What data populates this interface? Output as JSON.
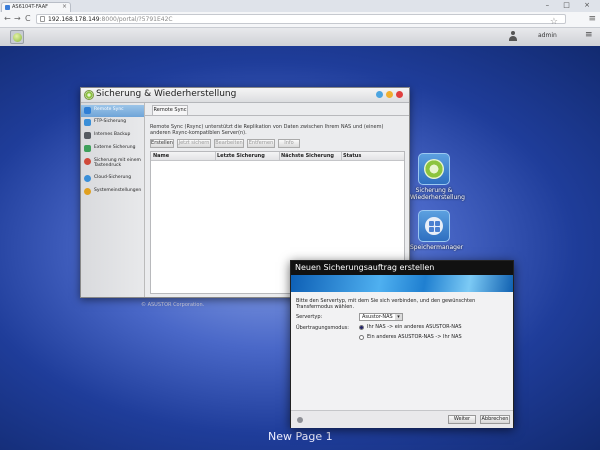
{
  "browser": {
    "tab_title": "AS6104T-FAAF",
    "tab_close": "×",
    "window_controls": "– □ ×",
    "url_host": "192.168.178.149",
    "url_rest": ":8000/portal/?5791E42C",
    "back": "←",
    "forward": "→",
    "reload": "C",
    "star": "☆",
    "menu": "≡"
  },
  "taskbar": {
    "username": "admin",
    "menu": "≡"
  },
  "desktop": {
    "icons": [
      {
        "label": "Sicherung & Wiederherstellung"
      },
      {
        "label": "Speichermanager"
      }
    ],
    "page_label": "New Page 1",
    "copyright": "© ASUSTOR Corporation."
  },
  "app": {
    "title": "Sicherung & Wiederherstellung",
    "sidebar": [
      {
        "label": "Remote Sync",
        "color": "#2e7fd6"
      },
      {
        "label": "FTP-Sicherung",
        "color": "#3a8fd8"
      },
      {
        "label": "Internes Backup",
        "color": "#555a60"
      },
      {
        "label": "Externe Sicherung",
        "color": "#3ea05a"
      },
      {
        "label": "Sicherung mit einem Tastendruck",
        "color": "#d04a3a"
      },
      {
        "label": "Cloud-Sicherung",
        "color": "#3a8fd8"
      },
      {
        "label": "Systemeinstellungen",
        "color": "#e0a020"
      }
    ],
    "tab": "Remote Sync",
    "description": "Remote Sync (Rsync) unterstützt die Replikation von Daten zwischen Ihrem NAS und (einem) anderen Rsync-kompatiblen Server(n).",
    "buttons": {
      "create": "Erstellen",
      "backup_now": "Jetzt sichern",
      "edit": "Bearbeiten",
      "remove": "Entfernen",
      "info": "Info"
    },
    "columns": [
      "Name",
      "Letzte Sicherung",
      "Nächste Sicherung",
      "Status"
    ]
  },
  "dialog": {
    "title": "Neuen Sicherungsauftrag erstellen",
    "description": "Bitte den Servertyp, mit dem Sie sich verbinden, und den gewünschten Transfermodus wählen.",
    "server_type_label": "Servertyp:",
    "server_type_value": "Asustor-NAS",
    "transfer_mode_label": "Übertragungsmodus:",
    "transfer_options": [
      {
        "label": "Ihr NAS -> ein anderes ASUSTOR-NAS",
        "selected": true
      },
      {
        "label": "Ein anderes ASUSTOR-NAS -> Ihr NAS",
        "selected": false
      }
    ],
    "next_button": "Weiter",
    "cancel_button": "Abbrechen"
  }
}
